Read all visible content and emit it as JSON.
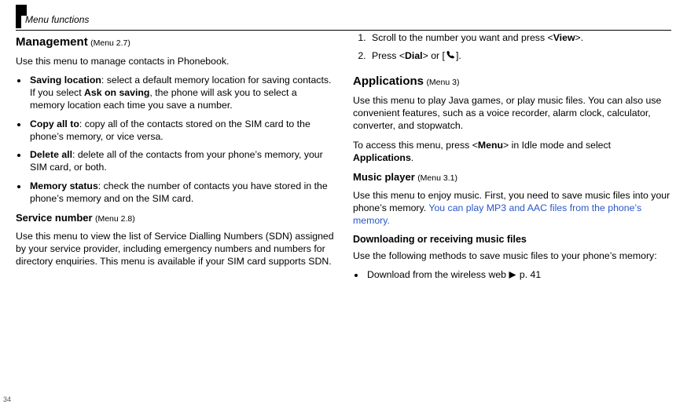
{
  "header": {
    "section": "Menu functions"
  },
  "pagenum": "34",
  "left": {
    "management": {
      "title": "Management",
      "sub": "(Menu 2.7)",
      "intro": "Use this menu to manage contacts in Phonebook.",
      "items": [
        {
          "b": "Saving location",
          "t": ": select a default memory location for saving contacts. If you select ",
          "b2": "Ask on saving",
          "t2": ", the phone will ask you to select a memory location each time you save a number."
        },
        {
          "b": "Copy all to",
          "t": ": copy all of the contacts stored on the SIM card to the phone’s memory, or vice versa."
        },
        {
          "b": "Delete all",
          "t": ": delete all of the contacts from your phone’s memory, your SIM card, or both."
        },
        {
          "b": "Memory status",
          "t": ": check the number of contacts you have stored in the phone’s memory and on the SIM card."
        }
      ]
    },
    "servicenum": {
      "title": "Service number",
      "sub": "(Menu 2.8)",
      "body": "Use this menu to view the list of Service Dialling Numbers (SDN) assigned by your service provider, including emergency numbers and numbers for directory enquiries. This menu is available if your SIM card supports SDN."
    }
  },
  "right": {
    "steps": {
      "s1a": "Scroll to the number you want and press <",
      "s1b": "View",
      "s1c": ">.",
      "s2a": "Press <",
      "s2b": "Dial",
      "s2c": "> or [",
      "s2d": "]."
    },
    "applications": {
      "title": "Applications",
      "sub": "(Menu 3)",
      "body": "Use this menu to play Java games, or play music files. You can also use convenient features, such as a voice recorder, alarm clock, calculator, converter, and stopwatch.",
      "access_a": "To access this menu, press <",
      "access_b": "Menu",
      "access_c": "> in Idle mode and select ",
      "access_d": "Applications",
      "access_e": "."
    },
    "music": {
      "title": "Music player",
      "sub": "(Menu 3.1)",
      "body_a": "Use this menu to enjoy music. First, you need to save music files into your phone’s memory. ",
      "body_blue": "You can play MP3 and AAC files from the phone’s memory.",
      "dl_h": "Downloading or receiving music files",
      "dl_body": "Use the following methods to save music files to your phone’s memory:",
      "dl_item_a": "Download from the wireless web",
      "dl_item_b": "p. 41"
    }
  }
}
